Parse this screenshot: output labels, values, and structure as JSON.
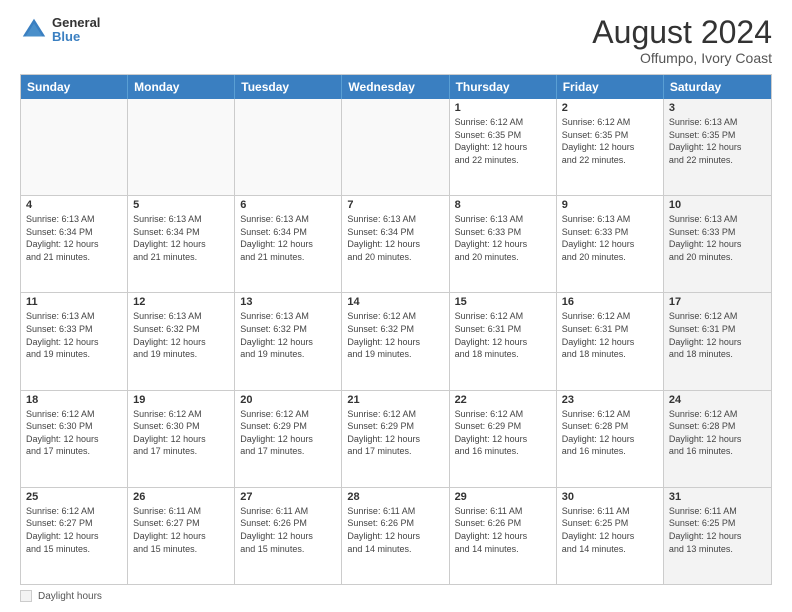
{
  "header": {
    "logo_line1": "General",
    "logo_line2": "Blue",
    "month_year": "August 2024",
    "location": "Offumpo, Ivory Coast"
  },
  "days_of_week": [
    "Sunday",
    "Monday",
    "Tuesday",
    "Wednesday",
    "Thursday",
    "Friday",
    "Saturday"
  ],
  "rows": [
    [
      {
        "day": "",
        "info": "",
        "empty": true
      },
      {
        "day": "",
        "info": "",
        "empty": true
      },
      {
        "day": "",
        "info": "",
        "empty": true
      },
      {
        "day": "",
        "info": "",
        "empty": true
      },
      {
        "day": "1",
        "info": "Sunrise: 6:12 AM\nSunset: 6:35 PM\nDaylight: 12 hours\nand 22 minutes.",
        "empty": false
      },
      {
        "day": "2",
        "info": "Sunrise: 6:12 AM\nSunset: 6:35 PM\nDaylight: 12 hours\nand 22 minutes.",
        "empty": false
      },
      {
        "day": "3",
        "info": "Sunrise: 6:13 AM\nSunset: 6:35 PM\nDaylight: 12 hours\nand 22 minutes.",
        "empty": false,
        "shaded": true
      }
    ],
    [
      {
        "day": "4",
        "info": "Sunrise: 6:13 AM\nSunset: 6:34 PM\nDaylight: 12 hours\nand 21 minutes.",
        "empty": false
      },
      {
        "day": "5",
        "info": "Sunrise: 6:13 AM\nSunset: 6:34 PM\nDaylight: 12 hours\nand 21 minutes.",
        "empty": false
      },
      {
        "day": "6",
        "info": "Sunrise: 6:13 AM\nSunset: 6:34 PM\nDaylight: 12 hours\nand 21 minutes.",
        "empty": false
      },
      {
        "day": "7",
        "info": "Sunrise: 6:13 AM\nSunset: 6:34 PM\nDaylight: 12 hours\nand 20 minutes.",
        "empty": false
      },
      {
        "day": "8",
        "info": "Sunrise: 6:13 AM\nSunset: 6:33 PM\nDaylight: 12 hours\nand 20 minutes.",
        "empty": false
      },
      {
        "day": "9",
        "info": "Sunrise: 6:13 AM\nSunset: 6:33 PM\nDaylight: 12 hours\nand 20 minutes.",
        "empty": false
      },
      {
        "day": "10",
        "info": "Sunrise: 6:13 AM\nSunset: 6:33 PM\nDaylight: 12 hours\nand 20 minutes.",
        "empty": false,
        "shaded": true
      }
    ],
    [
      {
        "day": "11",
        "info": "Sunrise: 6:13 AM\nSunset: 6:33 PM\nDaylight: 12 hours\nand 19 minutes.",
        "empty": false
      },
      {
        "day": "12",
        "info": "Sunrise: 6:13 AM\nSunset: 6:32 PM\nDaylight: 12 hours\nand 19 minutes.",
        "empty": false
      },
      {
        "day": "13",
        "info": "Sunrise: 6:13 AM\nSunset: 6:32 PM\nDaylight: 12 hours\nand 19 minutes.",
        "empty": false
      },
      {
        "day": "14",
        "info": "Sunrise: 6:12 AM\nSunset: 6:32 PM\nDaylight: 12 hours\nand 19 minutes.",
        "empty": false
      },
      {
        "day": "15",
        "info": "Sunrise: 6:12 AM\nSunset: 6:31 PM\nDaylight: 12 hours\nand 18 minutes.",
        "empty": false
      },
      {
        "day": "16",
        "info": "Sunrise: 6:12 AM\nSunset: 6:31 PM\nDaylight: 12 hours\nand 18 minutes.",
        "empty": false
      },
      {
        "day": "17",
        "info": "Sunrise: 6:12 AM\nSunset: 6:31 PM\nDaylight: 12 hours\nand 18 minutes.",
        "empty": false,
        "shaded": true
      }
    ],
    [
      {
        "day": "18",
        "info": "Sunrise: 6:12 AM\nSunset: 6:30 PM\nDaylight: 12 hours\nand 17 minutes.",
        "empty": false
      },
      {
        "day": "19",
        "info": "Sunrise: 6:12 AM\nSunset: 6:30 PM\nDaylight: 12 hours\nand 17 minutes.",
        "empty": false
      },
      {
        "day": "20",
        "info": "Sunrise: 6:12 AM\nSunset: 6:29 PM\nDaylight: 12 hours\nand 17 minutes.",
        "empty": false
      },
      {
        "day": "21",
        "info": "Sunrise: 6:12 AM\nSunset: 6:29 PM\nDaylight: 12 hours\nand 17 minutes.",
        "empty": false
      },
      {
        "day": "22",
        "info": "Sunrise: 6:12 AM\nSunset: 6:29 PM\nDaylight: 12 hours\nand 16 minutes.",
        "empty": false
      },
      {
        "day": "23",
        "info": "Sunrise: 6:12 AM\nSunset: 6:28 PM\nDaylight: 12 hours\nand 16 minutes.",
        "empty": false
      },
      {
        "day": "24",
        "info": "Sunrise: 6:12 AM\nSunset: 6:28 PM\nDaylight: 12 hours\nand 16 minutes.",
        "empty": false,
        "shaded": true
      }
    ],
    [
      {
        "day": "25",
        "info": "Sunrise: 6:12 AM\nSunset: 6:27 PM\nDaylight: 12 hours\nand 15 minutes.",
        "empty": false
      },
      {
        "day": "26",
        "info": "Sunrise: 6:11 AM\nSunset: 6:27 PM\nDaylight: 12 hours\nand 15 minutes.",
        "empty": false
      },
      {
        "day": "27",
        "info": "Sunrise: 6:11 AM\nSunset: 6:26 PM\nDaylight: 12 hours\nand 15 minutes.",
        "empty": false
      },
      {
        "day": "28",
        "info": "Sunrise: 6:11 AM\nSunset: 6:26 PM\nDaylight: 12 hours\nand 14 minutes.",
        "empty": false
      },
      {
        "day": "29",
        "info": "Sunrise: 6:11 AM\nSunset: 6:26 PM\nDaylight: 12 hours\nand 14 minutes.",
        "empty": false
      },
      {
        "day": "30",
        "info": "Sunrise: 6:11 AM\nSunset: 6:25 PM\nDaylight: 12 hours\nand 14 minutes.",
        "empty": false
      },
      {
        "day": "31",
        "info": "Sunrise: 6:11 AM\nSunset: 6:25 PM\nDaylight: 12 hours\nand 13 minutes.",
        "empty": false,
        "shaded": true
      }
    ]
  ],
  "footer": {
    "box_label": "Daylight hours"
  }
}
